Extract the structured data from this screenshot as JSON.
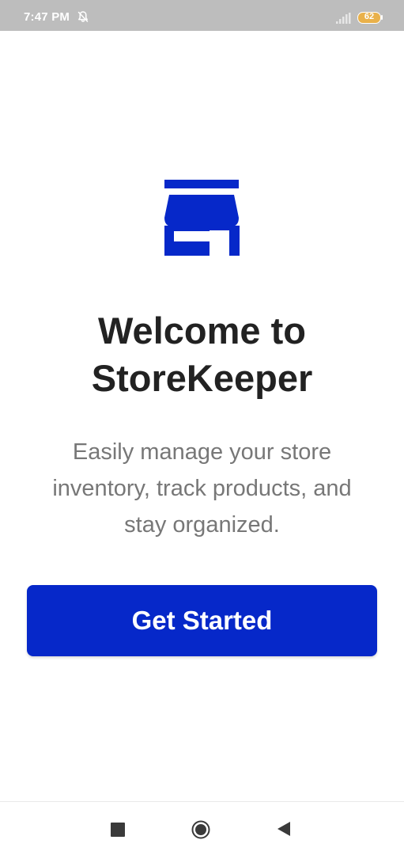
{
  "status_bar": {
    "time": "7:47 PM",
    "battery_level": "62",
    "icons": [
      "bell-off-icon",
      "signal-icon",
      "battery-icon"
    ],
    "battery_color": "#e9b14b"
  },
  "welcome": {
    "icon": "store-icon",
    "icon_color": "#0628c9",
    "title_lines": [
      "Welcome to",
      "StoreKeeper"
    ],
    "subtitle_lines": [
      "Easily manage your store",
      "inventory, track products, and",
      "stay organized."
    ],
    "cta_label": "Get Started",
    "accent_color": "#0628c9"
  },
  "nav_bar": {
    "buttons": [
      "recents-icon",
      "home-icon",
      "back-icon"
    ]
  }
}
